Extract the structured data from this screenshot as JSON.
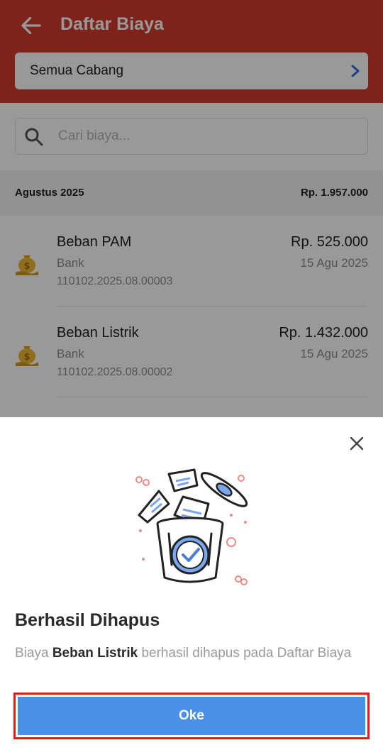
{
  "header": {
    "title": "Daftar Biaya",
    "back_icon": "arrow-left-icon",
    "accent_color": "#d03b2b"
  },
  "branch_selector": {
    "label": "Semua Cabang",
    "chevron_icon": "chevron-right-icon"
  },
  "search": {
    "placeholder": "Cari biaya...",
    "icon": "search-icon"
  },
  "group": {
    "month": "Agustus 2025",
    "total": "Rp. 1.957.000"
  },
  "items": [
    {
      "name": "Beban PAM",
      "account": "Bank",
      "code": "110102.2025.08.00003",
      "amount": "Rp. 525.000",
      "date": "15 Agu 2025",
      "icon": "money-bag-icon"
    },
    {
      "name": "Beban Listrik",
      "account": "Bank",
      "code": "110102.2025.08.00002",
      "amount": "Rp. 1.432.000",
      "date": "15 Agu 2025",
      "icon": "money-bag-icon"
    }
  ],
  "dialog": {
    "close_icon": "close-icon",
    "illustration": "trash-bin-illustration",
    "title": "Berhasil Dihapus",
    "message_prefix": "Biaya",
    "message_item": "Beban Listrik",
    "message_suffix": "berhasil dihapus pada Daftar Biaya",
    "ok_label": "Oke",
    "button_color": "#4a90e6",
    "highlight_color": "#e31b1b"
  }
}
